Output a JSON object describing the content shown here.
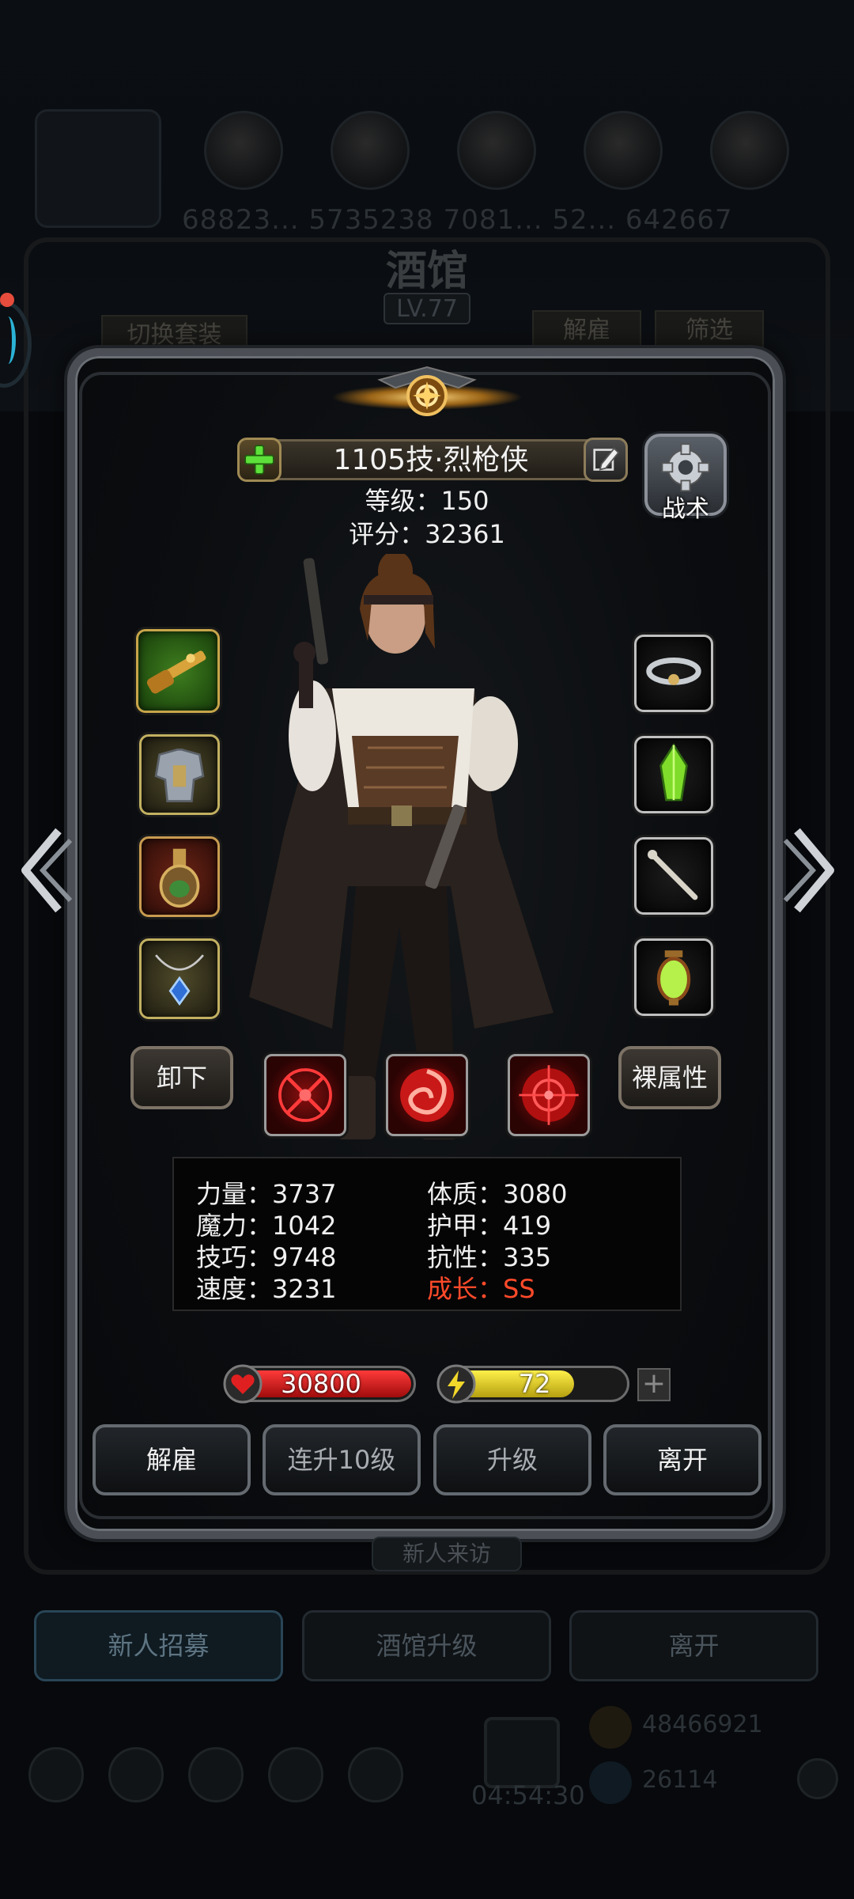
{
  "background": {
    "resource_values": "68823... 5735238  7081... 52... 642667",
    "title": "酒馆",
    "level": "LV.77",
    "switch_outfit_label": "切换套装",
    "dismiss_label": "解雇",
    "filter_label": "筛选",
    "new_visitor_label": "新人来访",
    "bottom_buttons": [
      "新人招募",
      "酒馆升级",
      "离开"
    ],
    "timer": "04:54:30",
    "gold": "48466921",
    "gems": "26114"
  },
  "hero": {
    "name": "1105技·烈枪侠",
    "level_text": "等级：150",
    "score_text": "评分：32361",
    "tactics_label": "战术"
  },
  "equipment": {
    "left": [
      "shotgun",
      "armor",
      "flask",
      "pendant"
    ],
    "right": [
      "cloud-ring",
      "green-crystal",
      "bone-weapon",
      "lantern"
    ]
  },
  "actions": {
    "unequip_label": "卸下",
    "naked_attr_label": "裸属性"
  },
  "attributes": {
    "strength": "力量：3737",
    "magic": "魔力：1042",
    "skill": "技巧：9748",
    "speed": "速度：3231",
    "constitution": "体质：3080",
    "armor": "护甲：419",
    "resistance": "抗性：335",
    "growth": "成长：SS"
  },
  "bars": {
    "hp_value": "30800",
    "energy_value": "72",
    "energy_fraction": 0.72
  },
  "panel_buttons": {
    "dismiss": "解雇",
    "level_up_10": "连升10级",
    "level_up": "升级",
    "leave": "离开"
  },
  "colors": {
    "hp": "#d01818",
    "energy": "#d8c81a",
    "growth_ss": "#ff4a2a"
  }
}
